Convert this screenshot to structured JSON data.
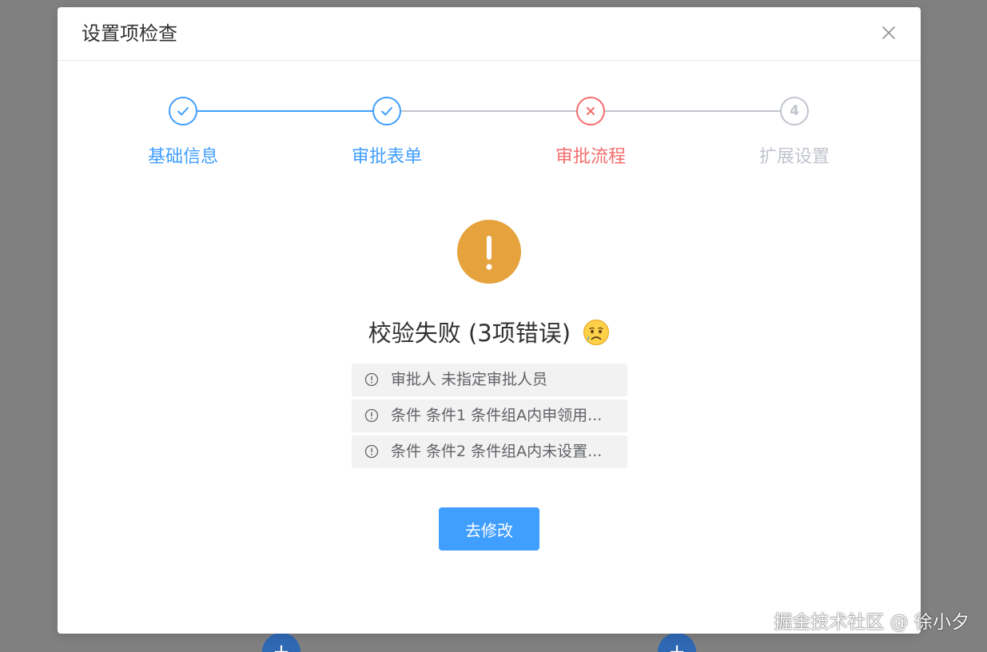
{
  "dialog": {
    "title": "设置项检查",
    "close_icon": "close-icon"
  },
  "steps": [
    {
      "label": "基础信息",
      "status": "success",
      "icon": "check-icon",
      "color": "#409eff"
    },
    {
      "label": "审批表单",
      "status": "success",
      "icon": "check-icon",
      "color": "#409eff"
    },
    {
      "label": "审批流程",
      "status": "error",
      "icon": "x-icon",
      "color": "#f56c6c"
    },
    {
      "label": "扩展设置",
      "status": "wait",
      "number": "4",
      "color": "#c0c4cc"
    }
  ],
  "result": {
    "icon": "warning-icon",
    "icon_color": "#e6a23c",
    "title": "校验失败 (3项错误)",
    "emoji": "😥"
  },
  "errors": [
    {
      "icon": "info-icon",
      "text": "审批人 未指定审批人员"
    },
    {
      "icon": "info-icon",
      "text": "条件 条件1 条件组A内申领用..."
    },
    {
      "icon": "info-icon",
      "text": "条件 条件2 条件组A内未设置..."
    }
  ],
  "actions": {
    "fix_label": "去修改",
    "fix_color": "#409eff"
  },
  "background": {
    "add_buttons": [
      "+",
      "+"
    ]
  },
  "watermark": "掘金技术社区 @ 徐小夕"
}
